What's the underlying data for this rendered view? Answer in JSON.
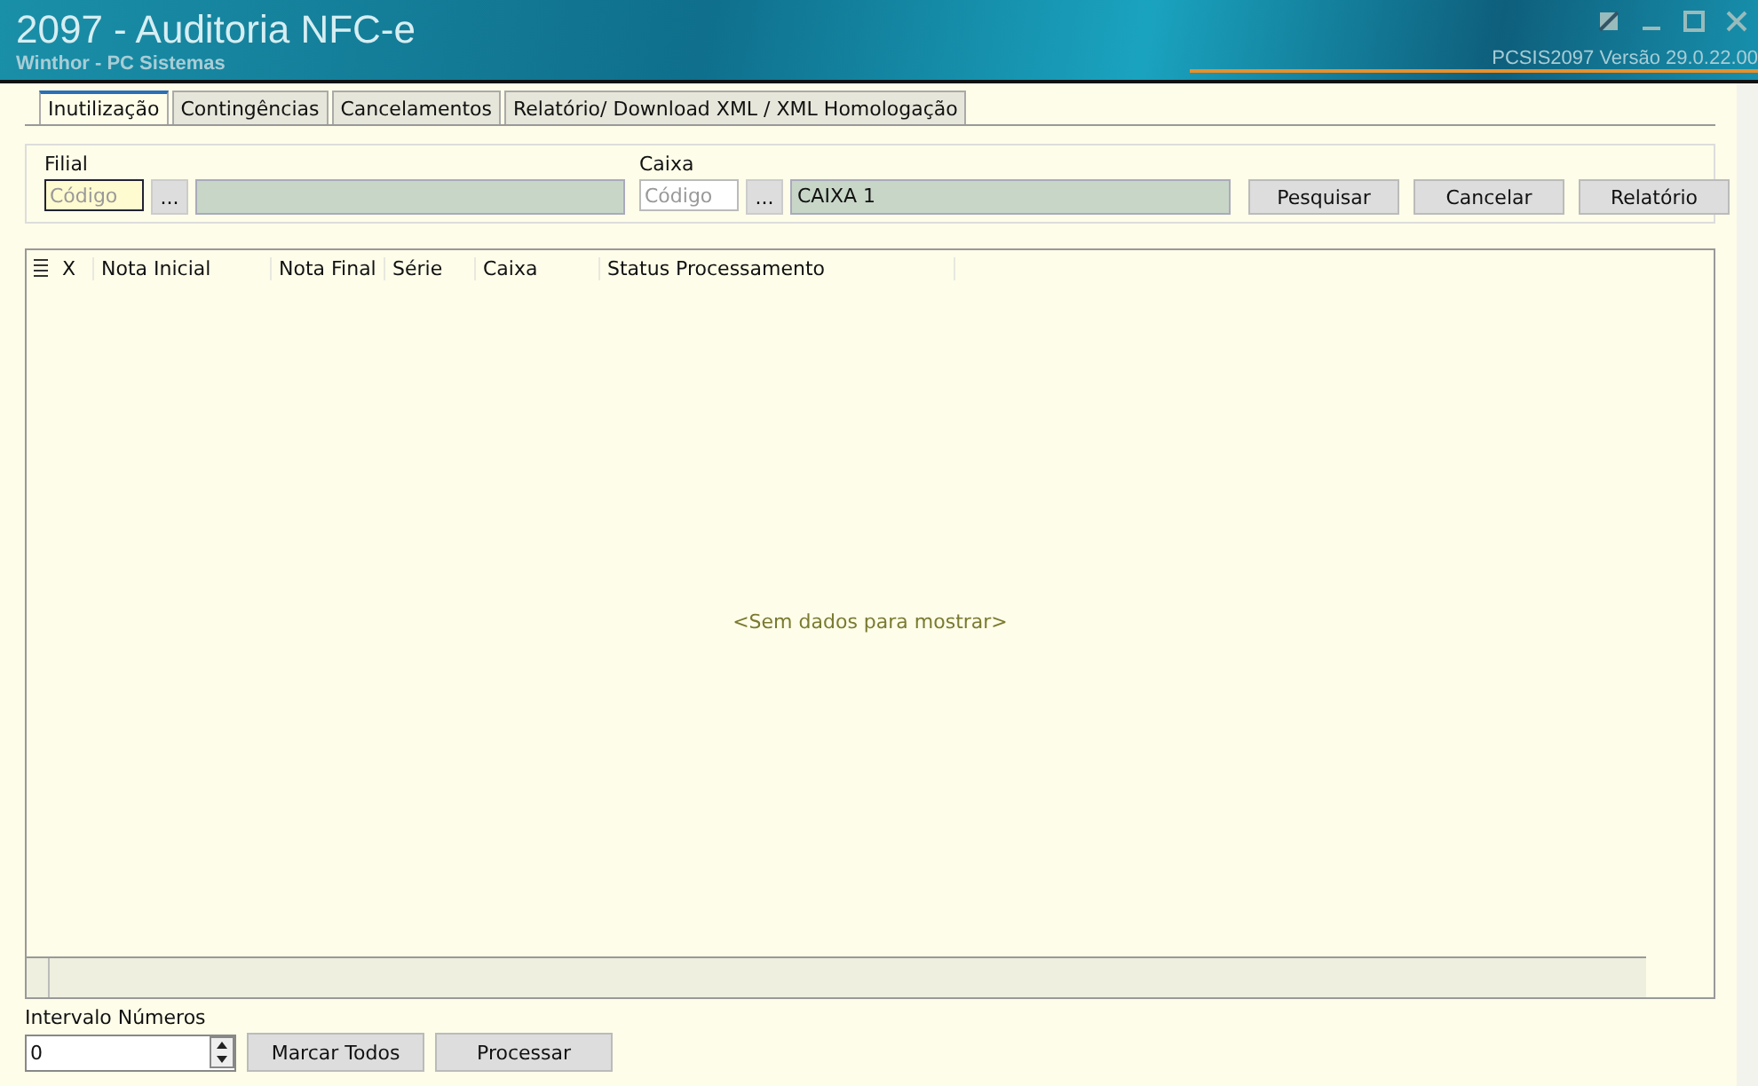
{
  "window": {
    "title": "2097 - Auditoria NFC-e",
    "subtitle": "Winthor - PC Sistemas",
    "version": "PCSIS2097  Versão  29.0.22.00"
  },
  "tabs": [
    {
      "label": "Inutilização",
      "selected": true
    },
    {
      "label": "Contingências",
      "selected": false
    },
    {
      "label": "Cancelamentos",
      "selected": false
    },
    {
      "label": "Relatório/ Download XML / XML Homologação",
      "selected": false
    }
  ],
  "filters": [
    {
      "label": "Filial",
      "placeholder": "Código",
      "focused": true
    },
    {
      "label": "Caixa",
      "placeholder": "Código",
      "description": "CAIXA 1",
      "focused": false
    }
  ],
  "lookup_button": "...",
  "actions": [
    "Pesquisar",
    "Cancelar",
    "Relatório"
  ],
  "table": {
    "columns": [
      "X",
      "Nota Inicial",
      "Nota Final",
      "Série",
      "Caixa",
      "Status Processamento"
    ],
    "empty_text": "<Sem dados para mostrar>"
  },
  "interval": {
    "label": "Intervalo Números",
    "value": "0"
  },
  "bottom_buttons": [
    "Marcar Todos",
    "Processar"
  ]
}
